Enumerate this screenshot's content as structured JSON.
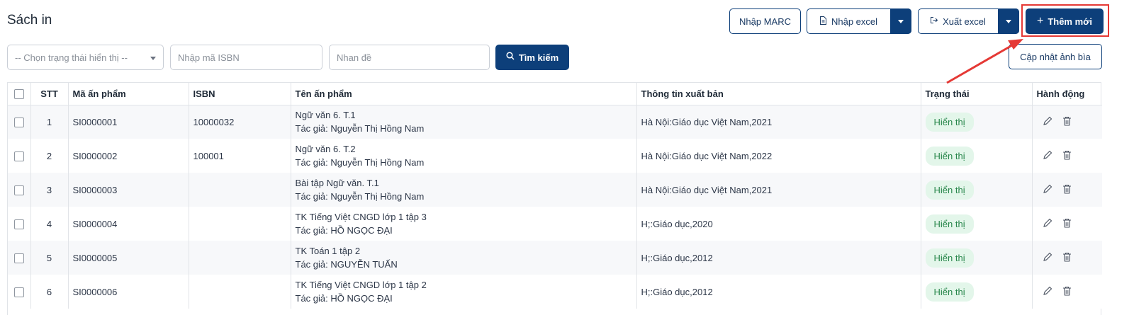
{
  "page": {
    "title": "Sách in"
  },
  "toolbar": {
    "import_marc": "Nhập MARC",
    "import_excel": "Nhập excel",
    "export_excel": "Xuất excel",
    "add_new": "Thêm mới",
    "update_cover": "Cập nhật ảnh bìa"
  },
  "filters": {
    "status_placeholder": "-- Chọn trạng thái hiển thị --",
    "isbn_placeholder": "Nhập mã ISBN",
    "title_placeholder": "Nhan đề",
    "search_label": "Tìm kiếm"
  },
  "table": {
    "headers": {
      "stt": "STT",
      "code": "Mã ấn phẩm",
      "isbn": "ISBN",
      "name": "Tên ấn phẩm",
      "publish": "Thông tin xuất bản",
      "status": "Trạng thái",
      "action": "Hành động"
    },
    "rows": [
      {
        "stt": "1",
        "code": "SI0000001",
        "isbn": "10000032",
        "title": "Ngữ văn 6. T.1",
        "author": "Tác giả: Nguyễn Thị Hồng Nam",
        "publish": "Hà Nội:Giáo dục Việt Nam,2021",
        "status": "Hiển thị"
      },
      {
        "stt": "2",
        "code": "SI0000002",
        "isbn": "100001",
        "title": "Ngữ văn 6. T.2",
        "author": "Tác giả: Nguyễn Thị Hồng Nam",
        "publish": "Hà Nội:Giáo dục Việt Nam,2022",
        "status": "Hiển thị"
      },
      {
        "stt": "3",
        "code": "SI0000003",
        "isbn": "",
        "title": "Bài tập Ngữ văn. T.1",
        "author": "Tác giả: Nguyễn Thị Hồng Nam",
        "publish": "Hà Nội:Giáo dục Việt Nam,2021",
        "status": "Hiển thị"
      },
      {
        "stt": "4",
        "code": "SI0000004",
        "isbn": "",
        "title": "TK Tiếng Việt CNGD lớp 1 tập 3",
        "author": "Tác giả: HỒ NGỌC ĐẠI",
        "publish": "H;:Giáo dục,2020",
        "status": "Hiển thị"
      },
      {
        "stt": "5",
        "code": "SI0000005",
        "isbn": "",
        "title": "TK Toán 1 tập 2",
        "author": "Tác giả: NGUYỄN TUẤN",
        "publish": "H;:Giáo dục,2012",
        "status": "Hiển thị"
      },
      {
        "stt": "6",
        "code": "SI0000006",
        "isbn": "",
        "title": "TK Tiếng Việt CNGD lớp 1 tập 2",
        "author": "Tác giả: HỒ NGỌC ĐẠI",
        "publish": "H;:Giáo dục,2012",
        "status": "Hiển thị"
      }
    ]
  },
  "icons": {
    "import_excel": "file-icon",
    "export_excel": "export-icon",
    "add_new": "plus-icon",
    "search": "search-icon",
    "edit": "pencil-icon",
    "delete": "trash-icon"
  },
  "colors": {
    "primary": "#0d3f7a",
    "badge_bg": "#e3f6ea",
    "badge_text": "#27864a",
    "annotation": "#e53935"
  }
}
